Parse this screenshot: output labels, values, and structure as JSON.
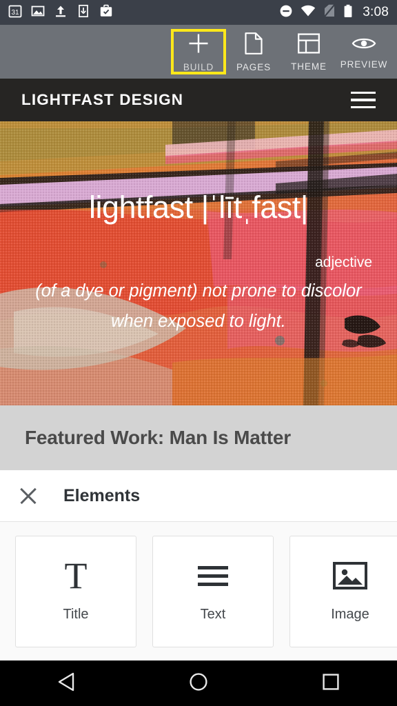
{
  "status_bar": {
    "left_icons": [
      {
        "name": "calendar-icon",
        "label": "31"
      },
      {
        "name": "photo-icon",
        "label": "image"
      },
      {
        "name": "upload-icon",
        "label": "upload"
      },
      {
        "name": "download-to-device-icon",
        "label": "download"
      },
      {
        "name": "work-briefcase-icon",
        "label": "work"
      }
    ],
    "right_icons": [
      {
        "name": "do-not-disturb-icon",
        "label": "dnd"
      },
      {
        "name": "wifi-icon",
        "label": "wifi"
      },
      {
        "name": "no-sim-icon",
        "label": "no-sim"
      },
      {
        "name": "battery-icon",
        "label": "battery"
      }
    ],
    "clock": "3:08",
    "background": "#3b4049"
  },
  "toolbar": {
    "background": "#6d7177",
    "selection_color": "#ffe81a",
    "items": [
      {
        "label": "BUILD",
        "icon": "plus-icon",
        "selected": true
      },
      {
        "label": "PAGES",
        "icon": "page-document-icon",
        "selected": false
      },
      {
        "label": "THEME",
        "icon": "layout-template-icon",
        "selected": false
      },
      {
        "label": "PREVIEW",
        "icon": "eye-icon",
        "selected": false
      }
    ]
  },
  "site": {
    "header": {
      "title": "LIGHTFAST DESIGN",
      "menu_icon": "hamburger-menu-icon",
      "background": "#262523"
    },
    "hero": {
      "word": "lightfast |ˈlītˌfast|",
      "part_of_speech": "adjective",
      "definition": "(of a dye or pigment) not prone to discolor when exposed to light.",
      "text_color": "#ffffff"
    },
    "featured": {
      "title": "Featured Work: Man Is Matter",
      "background": "#d3d3d3",
      "text_color": "#4a4a4a"
    }
  },
  "elements_sheet": {
    "close_icon": "close-icon",
    "title": "Elements",
    "cards": [
      {
        "label": "Title",
        "icon": "serif-t-icon",
        "glyph": "T"
      },
      {
        "label": "Text",
        "icon": "text-lines-icon"
      },
      {
        "label": "Image",
        "icon": "image-placeholder-icon"
      }
    ]
  },
  "nav_bar": {
    "background": "#000000",
    "buttons": [
      {
        "name": "back-button",
        "icon": "back-triangle-icon"
      },
      {
        "name": "home-button",
        "icon": "home-circle-icon"
      },
      {
        "name": "recents-button",
        "icon": "recents-square-icon"
      }
    ]
  }
}
